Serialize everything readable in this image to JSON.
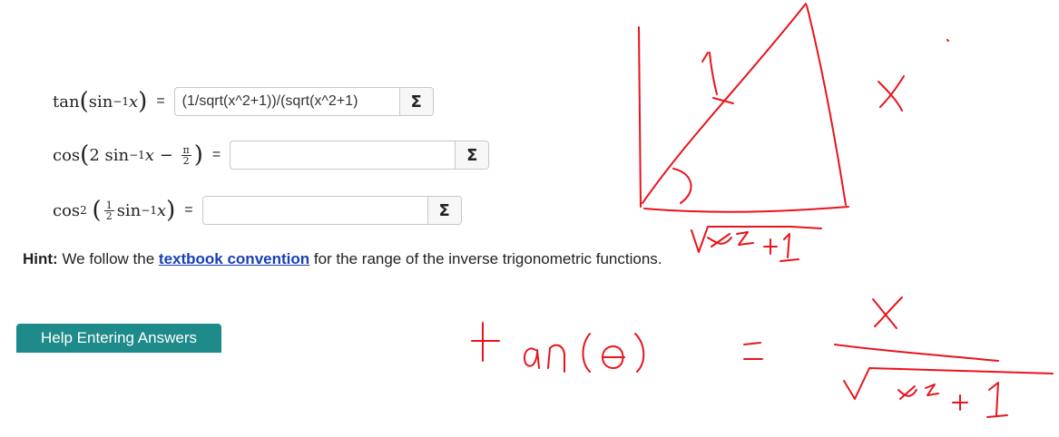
{
  "questions": [
    {
      "lhs": {
        "fn": "tan",
        "inner_fn": "sin",
        "inv": "−1",
        "var": "x"
      },
      "equals": "=",
      "answer_value": "(1/sqrt(x^2+1))/(sqrt(x^2+1)",
      "sigma_label": "Σ"
    },
    {
      "lhs": {
        "fn": "cos",
        "coef": "2",
        "inner_fn": "sin",
        "inv": "−1",
        "var": "x",
        "minus": "−",
        "pi_num": "π",
        "pi_den": "2"
      },
      "equals": "=",
      "answer_value": "",
      "sigma_label": "Σ"
    },
    {
      "lhs": {
        "fn": "cos",
        "pow": "2",
        "frac_num": "1",
        "frac_den": "2",
        "inner_fn": "sin",
        "inv": "−1",
        "var": "x"
      },
      "equals": "=",
      "answer_value": "",
      "sigma_label": "Σ"
    }
  ],
  "hint": {
    "label": "Hint:",
    "before": " We follow the ",
    "link": "textbook convention",
    "after": " for the range of the inverse trigonometric functions."
  },
  "help_button": {
    "label": "Help Entering Answers"
  },
  "annotation": {
    "color": "#e8141c"
  }
}
